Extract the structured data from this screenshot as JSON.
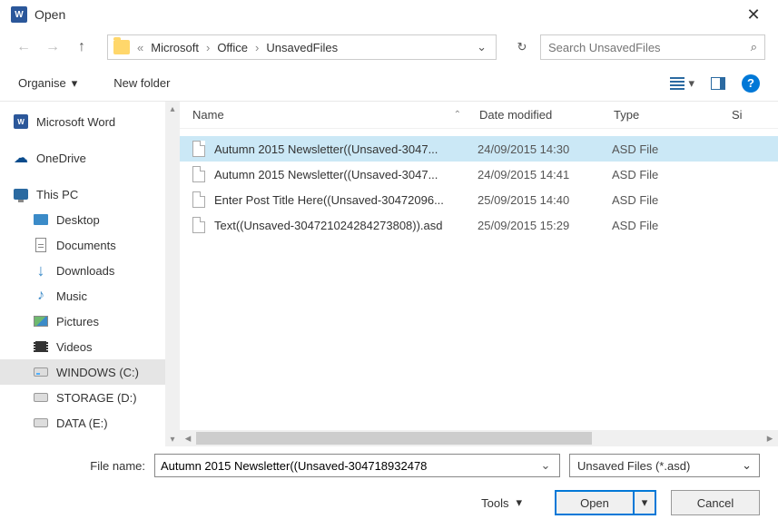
{
  "titlebar": {
    "app_icon_text": "W",
    "title": "Open"
  },
  "nav": {
    "breadcrumb": {
      "prefix": "«",
      "items": [
        "Microsoft",
        "Office",
        "UnsavedFiles"
      ]
    },
    "search_placeholder": "Search UnsavedFiles"
  },
  "toolbar": {
    "organise": "Organise",
    "new_folder": "New folder",
    "help": "?"
  },
  "sidebar": {
    "items": [
      {
        "icon": "word",
        "label": "Microsoft Word",
        "indent": false
      },
      {
        "icon": "cloud",
        "label": "OneDrive",
        "indent": false,
        "spacer_before": true
      },
      {
        "icon": "monitor",
        "label": "This PC",
        "indent": false,
        "spacer_before": true
      },
      {
        "icon": "desktop",
        "label": "Desktop",
        "indent": true
      },
      {
        "icon": "doc",
        "label": "Documents",
        "indent": true
      },
      {
        "icon": "download",
        "label": "Downloads",
        "indent": true
      },
      {
        "icon": "music",
        "label": "Music",
        "indent": true
      },
      {
        "icon": "pic",
        "label": "Pictures",
        "indent": true
      },
      {
        "icon": "video",
        "label": "Videos",
        "indent": true
      },
      {
        "icon": "drive-c",
        "label": "WINDOWS (C:)",
        "indent": true,
        "selected": true
      },
      {
        "icon": "drive",
        "label": "STORAGE (D:)",
        "indent": true
      },
      {
        "icon": "drive",
        "label": "DATA (E:)",
        "indent": true
      }
    ]
  },
  "columns": {
    "name": "Name",
    "date": "Date modified",
    "type": "Type",
    "size": "Si"
  },
  "files": [
    {
      "name": "Autumn 2015 Newsletter((Unsaved-3047...",
      "date": "24/09/2015 14:30",
      "type": "ASD File",
      "selected": true
    },
    {
      "name": "Autumn 2015 Newsletter((Unsaved-3047...",
      "date": "24/09/2015 14:41",
      "type": "ASD File",
      "selected": false
    },
    {
      "name": "Enter Post Title Here((Unsaved-30472096...",
      "date": "25/09/2015 14:40",
      "type": "ASD File",
      "selected": false
    },
    {
      "name": "Text((Unsaved-304721024284273808)).asd",
      "date": "25/09/2015 15:29",
      "type": "ASD File",
      "selected": false
    }
  ],
  "footer": {
    "filename_label": "File name:",
    "filename_value": "Autumn 2015 Newsletter((Unsaved-304718932478",
    "filter": "Unsaved Files (*.asd)",
    "tools": "Tools",
    "open": "Open",
    "cancel": "Cancel"
  }
}
